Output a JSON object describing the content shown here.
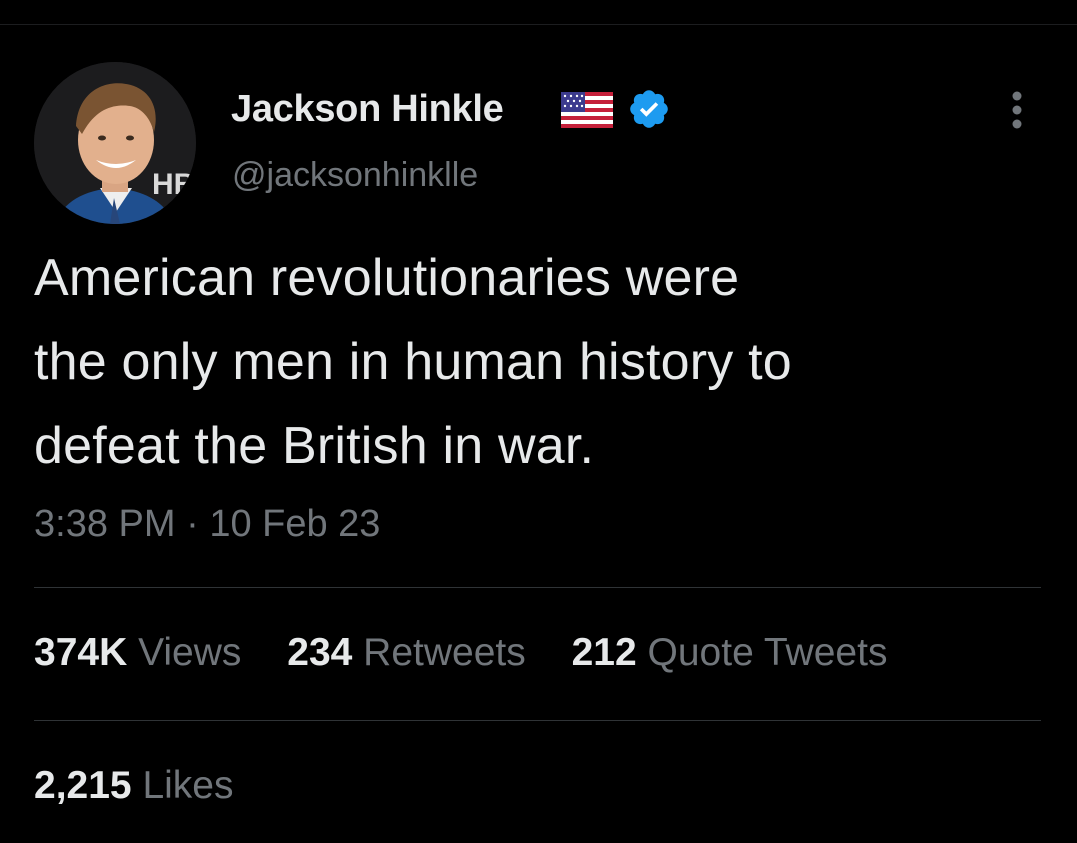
{
  "tweet": {
    "author": {
      "display_name": "Jackson Hinkle",
      "handle": "@jacksonhinklle",
      "flag_icon": "us-flag-icon",
      "verified_icon": "verified-badge-icon",
      "verified_color": "#1d9bf0"
    },
    "text_lines": [
      "American revolutionaries were",
      "the only men in human history to",
      "defeat the British in war."
    ],
    "time": "3:38 PM",
    "separator": "·",
    "date": "10 Feb 23",
    "stats": [
      {
        "count": "374K",
        "label": "Views"
      },
      {
        "count": "234",
        "label": "Retweets"
      },
      {
        "count": "212",
        "label": "Quote Tweets"
      }
    ],
    "likes": {
      "count": "2,215",
      "label": "Likes"
    },
    "more_icon": "more-options-icon"
  },
  "theme": {
    "background": "#000000",
    "text_primary": "#e7e9ea",
    "text_secondary": "#71767b",
    "divider": "#2f3336"
  }
}
